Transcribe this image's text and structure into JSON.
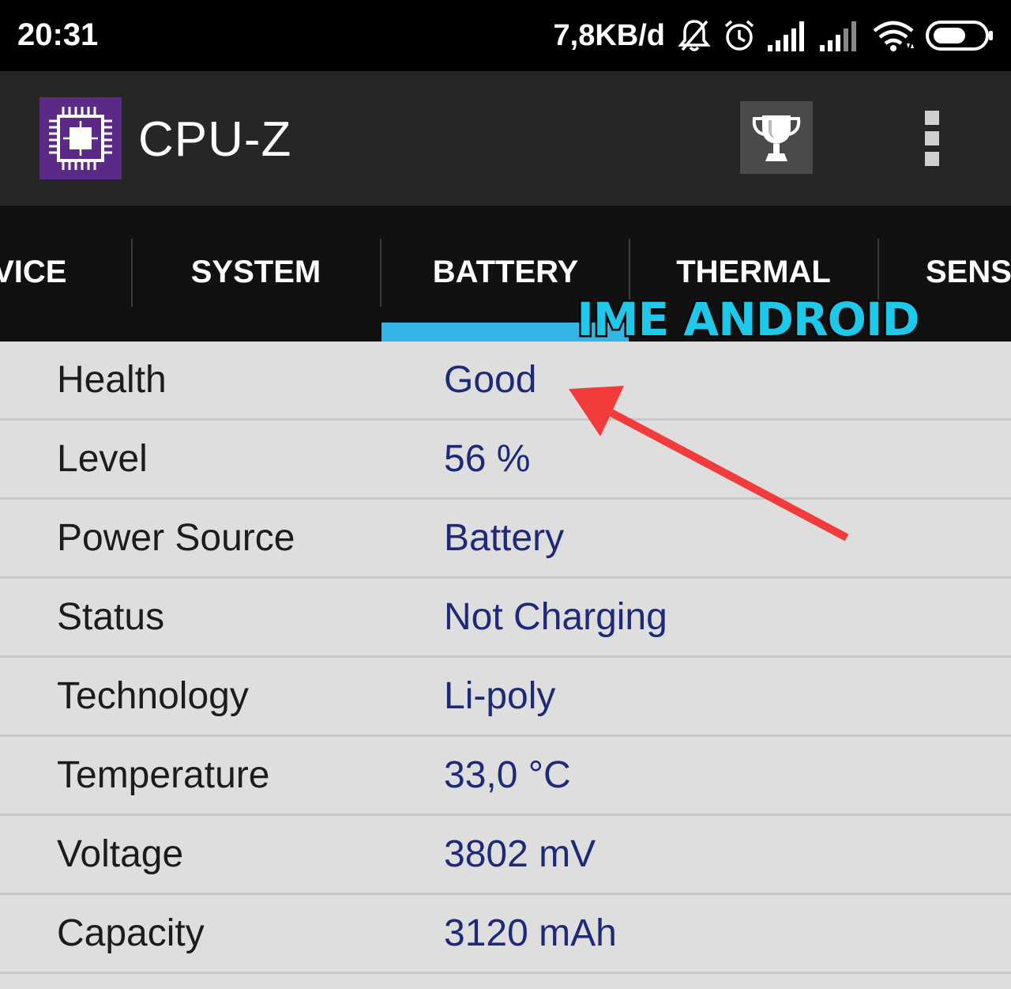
{
  "status_bar": {
    "time": "20:31",
    "network_speed": "7,8KB/d",
    "icons": [
      "notifications-muted-icon",
      "alarm-icon",
      "signal-sim1-icon",
      "signal-sim2-icon",
      "wifi-icon",
      "battery-icon"
    ]
  },
  "app_bar": {
    "title": "CPU-Z",
    "logo_icon": "cpu-chip-icon",
    "actions": [
      "trophy-icon",
      "overflow-menu-icon"
    ]
  },
  "tabs": {
    "items": [
      {
        "label": "DEVICE"
      },
      {
        "label": "SYSTEM"
      },
      {
        "label": "BATTERY"
      },
      {
        "label": "THERMAL"
      },
      {
        "label": "SENSORS"
      }
    ],
    "selected": "BATTERY"
  },
  "watermark": {
    "text": "IME ANDROID"
  },
  "battery": {
    "rows": [
      {
        "label": "Health",
        "value": "Good"
      },
      {
        "label": "Level",
        "value": "56 %"
      },
      {
        "label": "Power Source",
        "value": "Battery"
      },
      {
        "label": "Status",
        "value": "Not Charging"
      },
      {
        "label": "Technology",
        "value": "Li-poly"
      },
      {
        "label": "Temperature",
        "value": "33,0 °C"
      },
      {
        "label": "Voltage",
        "value": "3802 mV"
      },
      {
        "label": "Capacity",
        "value": "3120 mAh"
      }
    ]
  },
  "colors": {
    "accent": "#33b5e5",
    "value_text": "#1e2a78",
    "annotation_arrow": "#f23c3c",
    "logo_bg": "#5b2a86"
  }
}
